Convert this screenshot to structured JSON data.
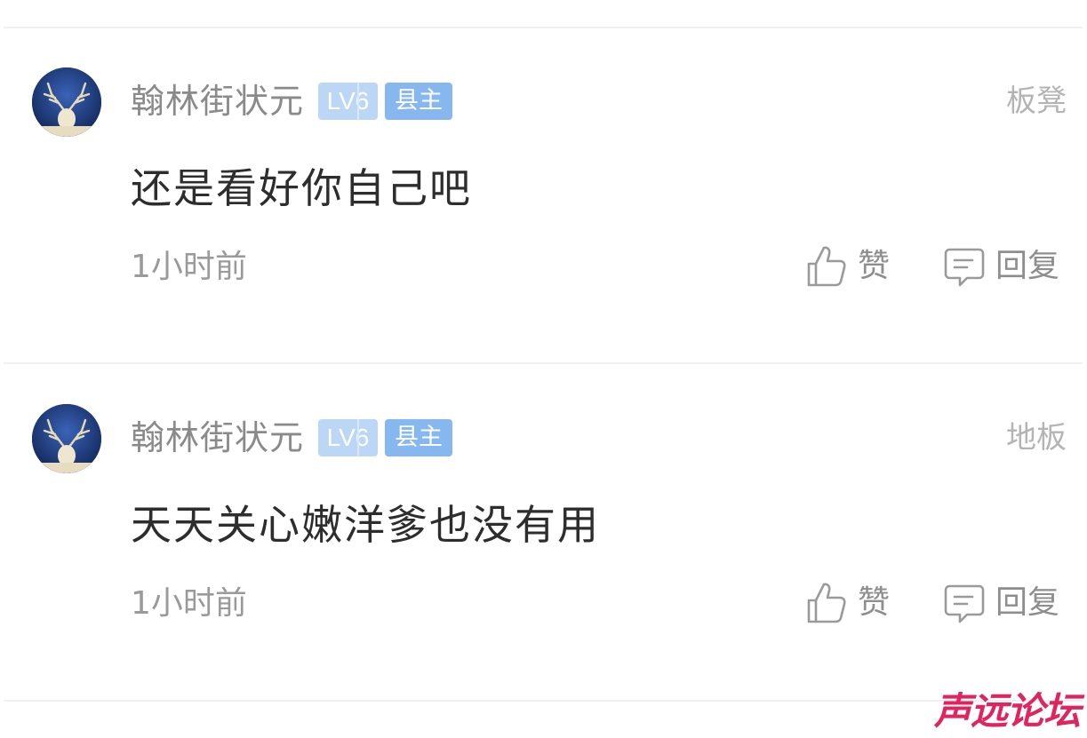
{
  "comments": [
    {
      "username": "翰林街状元",
      "level": "LV6",
      "title": "县主",
      "floor": "板凳",
      "content": "还是看好你自己吧",
      "time": "1小时前",
      "like_label": "赞",
      "reply_label": "回复"
    },
    {
      "username": "翰林街状元",
      "level": "LV6",
      "title": "县主",
      "floor": "地板",
      "content": "天天关心嫩洋爹也没有用",
      "time": "1小时前",
      "like_label": "赞",
      "reply_label": "回复"
    }
  ],
  "watermark": "声远论坛",
  "colors": {
    "level_badge": "#bcd7f6",
    "title_badge": "#86b7ee",
    "watermark": "#e0245e",
    "avatar_bg": "#1d3b7c"
  },
  "icons": {
    "like": "thumbs-up-icon",
    "reply": "comment-bubble-icon"
  }
}
